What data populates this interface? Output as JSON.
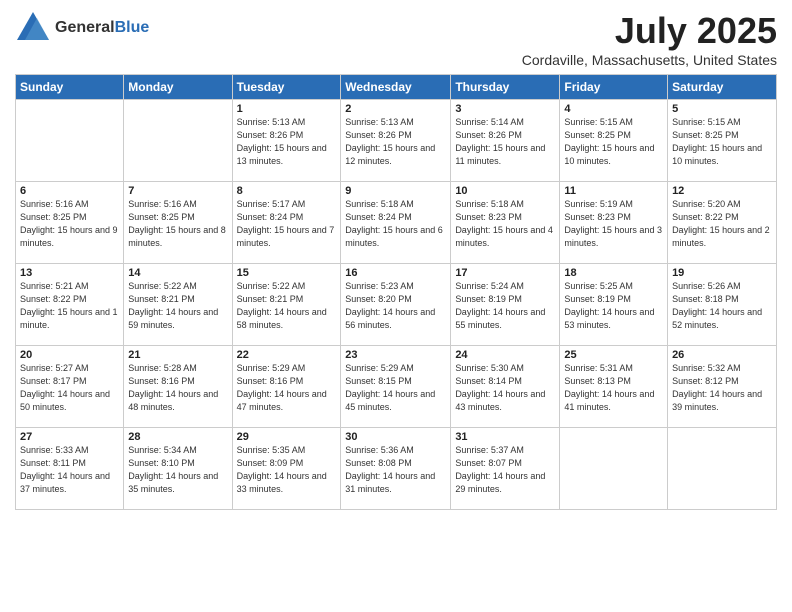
{
  "header": {
    "logo_general": "General",
    "logo_blue": "Blue",
    "main_title": "July 2025",
    "subtitle": "Cordaville, Massachusetts, United States"
  },
  "weekdays": [
    "Sunday",
    "Monday",
    "Tuesday",
    "Wednesday",
    "Thursday",
    "Friday",
    "Saturday"
  ],
  "weeks": [
    [
      {
        "day": "",
        "info": ""
      },
      {
        "day": "",
        "info": ""
      },
      {
        "day": "1",
        "info": "Sunrise: 5:13 AM\nSunset: 8:26 PM\nDaylight: 15 hours and 13 minutes."
      },
      {
        "day": "2",
        "info": "Sunrise: 5:13 AM\nSunset: 8:26 PM\nDaylight: 15 hours and 12 minutes."
      },
      {
        "day": "3",
        "info": "Sunrise: 5:14 AM\nSunset: 8:26 PM\nDaylight: 15 hours and 11 minutes."
      },
      {
        "day": "4",
        "info": "Sunrise: 5:15 AM\nSunset: 8:25 PM\nDaylight: 15 hours and 10 minutes."
      },
      {
        "day": "5",
        "info": "Sunrise: 5:15 AM\nSunset: 8:25 PM\nDaylight: 15 hours and 10 minutes."
      }
    ],
    [
      {
        "day": "6",
        "info": "Sunrise: 5:16 AM\nSunset: 8:25 PM\nDaylight: 15 hours and 9 minutes."
      },
      {
        "day": "7",
        "info": "Sunrise: 5:16 AM\nSunset: 8:25 PM\nDaylight: 15 hours and 8 minutes."
      },
      {
        "day": "8",
        "info": "Sunrise: 5:17 AM\nSunset: 8:24 PM\nDaylight: 15 hours and 7 minutes."
      },
      {
        "day": "9",
        "info": "Sunrise: 5:18 AM\nSunset: 8:24 PM\nDaylight: 15 hours and 6 minutes."
      },
      {
        "day": "10",
        "info": "Sunrise: 5:18 AM\nSunset: 8:23 PM\nDaylight: 15 hours and 4 minutes."
      },
      {
        "day": "11",
        "info": "Sunrise: 5:19 AM\nSunset: 8:23 PM\nDaylight: 15 hours and 3 minutes."
      },
      {
        "day": "12",
        "info": "Sunrise: 5:20 AM\nSunset: 8:22 PM\nDaylight: 15 hours and 2 minutes."
      }
    ],
    [
      {
        "day": "13",
        "info": "Sunrise: 5:21 AM\nSunset: 8:22 PM\nDaylight: 15 hours and 1 minute."
      },
      {
        "day": "14",
        "info": "Sunrise: 5:22 AM\nSunset: 8:21 PM\nDaylight: 14 hours and 59 minutes."
      },
      {
        "day": "15",
        "info": "Sunrise: 5:22 AM\nSunset: 8:21 PM\nDaylight: 14 hours and 58 minutes."
      },
      {
        "day": "16",
        "info": "Sunrise: 5:23 AM\nSunset: 8:20 PM\nDaylight: 14 hours and 56 minutes."
      },
      {
        "day": "17",
        "info": "Sunrise: 5:24 AM\nSunset: 8:19 PM\nDaylight: 14 hours and 55 minutes."
      },
      {
        "day": "18",
        "info": "Sunrise: 5:25 AM\nSunset: 8:19 PM\nDaylight: 14 hours and 53 minutes."
      },
      {
        "day": "19",
        "info": "Sunrise: 5:26 AM\nSunset: 8:18 PM\nDaylight: 14 hours and 52 minutes."
      }
    ],
    [
      {
        "day": "20",
        "info": "Sunrise: 5:27 AM\nSunset: 8:17 PM\nDaylight: 14 hours and 50 minutes."
      },
      {
        "day": "21",
        "info": "Sunrise: 5:28 AM\nSunset: 8:16 PM\nDaylight: 14 hours and 48 minutes."
      },
      {
        "day": "22",
        "info": "Sunrise: 5:29 AM\nSunset: 8:16 PM\nDaylight: 14 hours and 47 minutes."
      },
      {
        "day": "23",
        "info": "Sunrise: 5:29 AM\nSunset: 8:15 PM\nDaylight: 14 hours and 45 minutes."
      },
      {
        "day": "24",
        "info": "Sunrise: 5:30 AM\nSunset: 8:14 PM\nDaylight: 14 hours and 43 minutes."
      },
      {
        "day": "25",
        "info": "Sunrise: 5:31 AM\nSunset: 8:13 PM\nDaylight: 14 hours and 41 minutes."
      },
      {
        "day": "26",
        "info": "Sunrise: 5:32 AM\nSunset: 8:12 PM\nDaylight: 14 hours and 39 minutes."
      }
    ],
    [
      {
        "day": "27",
        "info": "Sunrise: 5:33 AM\nSunset: 8:11 PM\nDaylight: 14 hours and 37 minutes."
      },
      {
        "day": "28",
        "info": "Sunrise: 5:34 AM\nSunset: 8:10 PM\nDaylight: 14 hours and 35 minutes."
      },
      {
        "day": "29",
        "info": "Sunrise: 5:35 AM\nSunset: 8:09 PM\nDaylight: 14 hours and 33 minutes."
      },
      {
        "day": "30",
        "info": "Sunrise: 5:36 AM\nSunset: 8:08 PM\nDaylight: 14 hours and 31 minutes."
      },
      {
        "day": "31",
        "info": "Sunrise: 5:37 AM\nSunset: 8:07 PM\nDaylight: 14 hours and 29 minutes."
      },
      {
        "day": "",
        "info": ""
      },
      {
        "day": "",
        "info": ""
      }
    ]
  ]
}
